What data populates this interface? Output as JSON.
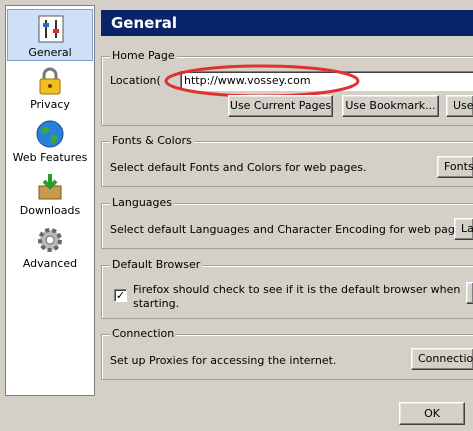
{
  "sidebar": {
    "items": [
      {
        "label": "General",
        "icon": "general-settings-icon",
        "selected": true
      },
      {
        "label": "Privacy",
        "icon": "padlock-icon"
      },
      {
        "label": "Web Features",
        "icon": "globe-icon"
      },
      {
        "label": "Downloads",
        "icon": "download-box-icon"
      },
      {
        "label": "Advanced",
        "icon": "gear-icon"
      }
    ]
  },
  "header": {
    "title": "General"
  },
  "home_page": {
    "legend": "Home Page",
    "location_label": "Location(",
    "location_value": "http://www.vossey.com",
    "highlight_color": "#e03030",
    "buttons": {
      "current": "Use Current Pages",
      "bookmark": "Use Bookmark...",
      "blank": "Use"
    }
  },
  "fonts": {
    "legend": "Fonts & Colors",
    "text": "Select default Fonts and Colors for web pages.",
    "button": "Fonts"
  },
  "languages": {
    "legend": "Languages",
    "text": "Select default Languages and Character Encoding for web pages.",
    "button": "La"
  },
  "default_browser": {
    "legend": "Default Browser",
    "checked": true,
    "check_text_1": "Firefox should check to see if it is the default browser when",
    "check_text_2": "starting."
  },
  "connection": {
    "legend": "Connection",
    "text": "Set up Proxies for accessing the internet.",
    "button": "Connection"
  },
  "footer": {
    "ok": "OK"
  },
  "colors": {
    "header_bg": "#0a246a",
    "selection_bg": "#cde0f7"
  }
}
